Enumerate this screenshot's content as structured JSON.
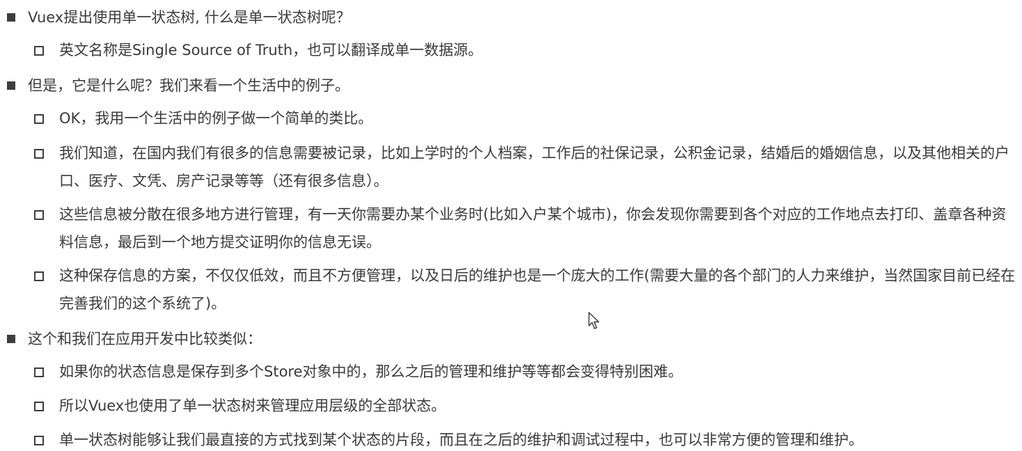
{
  "items": [
    {
      "level": 1,
      "text": "Vuex提出使用单一状态树, 什么是单一状态树呢？",
      "children": [
        {
          "level": 2,
          "text": "英文名称是Single Source of Truth，也可以翻译成单一数据源。"
        }
      ]
    },
    {
      "level": 1,
      "text": "但是，它是什么呢？我们来看一个生活中的例子。",
      "children": [
        {
          "level": 2,
          "text": "OK，我用一个生活中的例子做一个简单的类比。"
        },
        {
          "level": 2,
          "text": "我们知道，在国内我们有很多的信息需要被记录，比如上学时的个人档案，工作后的社保记录，公积金记录，结婚后的婚姻信息，以及其他相关的户口、医疗、文凭、房产记录等等（还有很多信息）。"
        },
        {
          "level": 2,
          "text": "这些信息被分散在很多地方进行管理，有一天你需要办某个业务时(比如入户某个城市)，你会发现你需要到各个对应的工作地点去打印、盖章各种资料信息，最后到一个地方提交证明你的信息无误。"
        },
        {
          "level": 2,
          "text": "这种保存信息的方案，不仅仅低效，而且不方便管理，以及日后的维护也是一个庞大的工作(需要大量的各个部门的人力来维护，当然国家目前已经在完善我们的这个系统了)。"
        }
      ]
    },
    {
      "level": 1,
      "text": "这个和我们在应用开发中比较类似：",
      "children": [
        {
          "level": 2,
          "text": "如果你的状态信息是保存到多个Store对象中的，那么之后的管理和维护等等都会变得特别困难。"
        },
        {
          "level": 2,
          "text": "所以Vuex也使用了单一状态树来管理应用层级的全部状态。"
        },
        {
          "level": 2,
          "text": "单一状态树能够让我们最直接的方式找到某个状态的片段，而且在之后的维护和调试过程中，也可以非常方便的管理和维护。"
        }
      ]
    }
  ],
  "icons": {
    "level1_marker": "filled-square-bullet-icon",
    "level2_marker": "hollow-square-bullet-icon",
    "cursor": "mouse-pointer-icon"
  },
  "colors": {
    "text": "#3a3a3a",
    "bullet": "#3d3d3d",
    "background": "#ffffff"
  }
}
